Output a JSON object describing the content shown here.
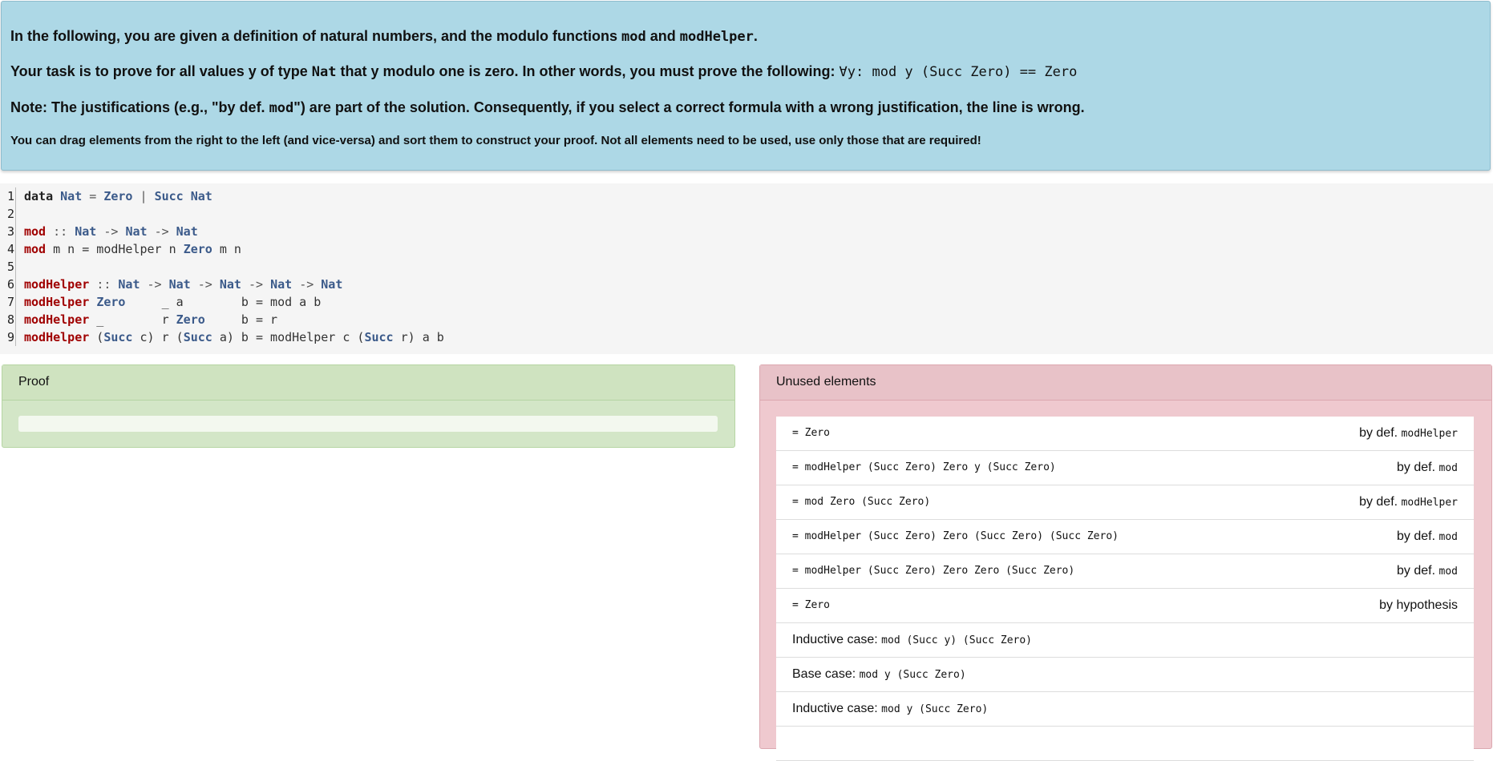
{
  "instructions": {
    "line1": {
      "pre": "In the following, you are given a definition of natural numbers, and the modulo functions ",
      "code1": "mod",
      "mid": " and ",
      "code2": "modHelper",
      "post": "."
    },
    "line2": {
      "pre": "Your task is to prove for all values y of type ",
      "code": "Nat",
      "post": " that y modulo one is zero. In other words, you must prove the following: ",
      "formula": "∀y: mod y (Succ Zero) == Zero"
    },
    "line3": {
      "pre": "Note: The justifications (e.g., \"by def. ",
      "code": "mod",
      "post": "\") are part of the solution. Consequently, if you select a correct formula with a wrong justification, the line is wrong."
    },
    "line4": "You can drag elements from the right to the left (and vice-versa) and sort them to construct your proof. Not all elements need to be used, use only those that are required!"
  },
  "code": {
    "line_numbers": [
      "1",
      "2",
      "3",
      "4",
      "5",
      "6",
      "7",
      "8",
      "9"
    ]
  },
  "proof": {
    "title": "Proof"
  },
  "unused": {
    "title": "Unused elements",
    "items": [
      {
        "formula": "= Zero",
        "just_prefix": "by def. ",
        "just_code": "modHelper"
      },
      {
        "formula": "= modHelper (Succ Zero) Zero y (Succ Zero)",
        "just_prefix": "by def. ",
        "just_code": "mod"
      },
      {
        "formula": "= mod Zero (Succ Zero)",
        "just_prefix": "by def. ",
        "just_code": "modHelper"
      },
      {
        "formula": "= modHelper (Succ Zero) Zero (Succ Zero) (Succ Zero)",
        "just_prefix": "by def. ",
        "just_code": "mod"
      },
      {
        "formula": "= modHelper (Succ Zero) Zero Zero (Succ Zero)",
        "just_prefix": "by def. ",
        "just_code": "mod"
      },
      {
        "formula": "= Zero",
        "just_prefix": "by hypothesis",
        "just_code": ""
      },
      {
        "label": "Inductive case: ",
        "formula": "mod (Succ y) (Succ Zero)",
        "just_prefix": "",
        "just_code": ""
      },
      {
        "label": "Base case: ",
        "formula": "mod y (Succ Zero)",
        "just_prefix": "",
        "just_code": ""
      },
      {
        "label": "Inductive case: ",
        "formula": "mod y (Succ Zero)",
        "just_prefix": "",
        "just_code": ""
      }
    ]
  }
}
